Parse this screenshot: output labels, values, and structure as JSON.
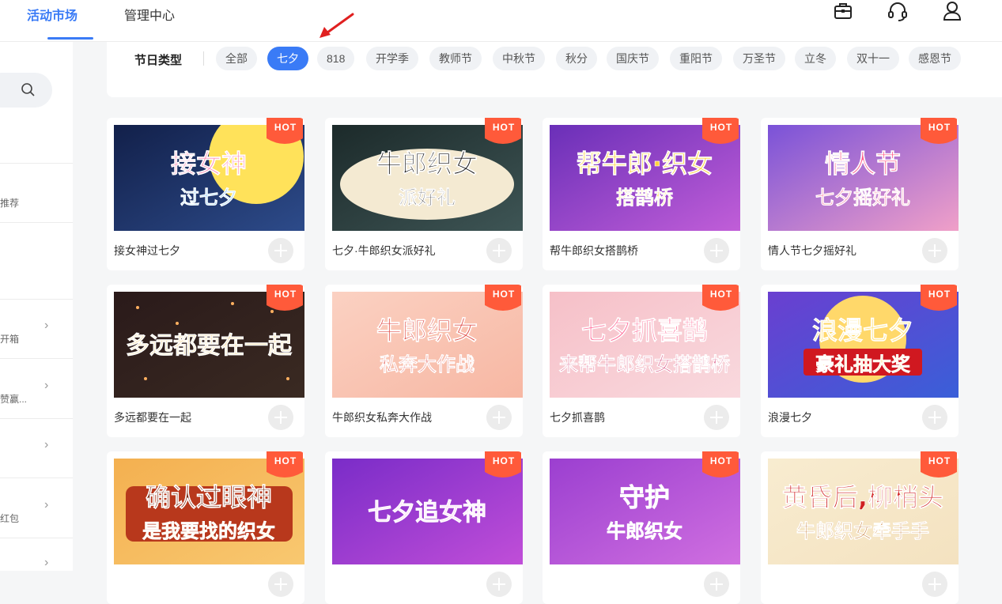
{
  "topnav": {
    "tabs": [
      {
        "label": "活动市场",
        "active": true
      },
      {
        "label": "管理中心",
        "active": false
      }
    ],
    "icons": [
      "briefcase-icon",
      "headset-icon",
      "user-icon"
    ],
    "accent_color": "#3a7bf6"
  },
  "sidebar": {
    "items": [
      {
        "label": "推荐"
      },
      {
        "label": "开箱"
      },
      {
        "label": "赞赢..."
      },
      {
        "label": ""
      },
      {
        "label": "红包"
      },
      {
        "label": ""
      }
    ]
  },
  "filter": {
    "title": "节日类型",
    "chips": [
      "全部",
      "七夕",
      "818",
      "开学季",
      "教师节",
      "中秋节",
      "秋分",
      "国庆节",
      "重阳节",
      "万圣节",
      "立冬",
      "双十一",
      "感恩节"
    ],
    "active": "七夕"
  },
  "hot_label": "HOT",
  "cards": [
    {
      "title": "接女神过七夕",
      "thumb_text": [
        "接女神",
        "过七夕"
      ]
    },
    {
      "title": "七夕·牛郎织女派好礼",
      "thumb_text": [
        "牛郎织女",
        "派好礼"
      ]
    },
    {
      "title": "帮牛郎织女搭鹊桥",
      "thumb_text": [
        "帮牛郎·织女",
        "搭鹊桥"
      ]
    },
    {
      "title": "情人节七夕摇好礼",
      "thumb_text": [
        "情人节",
        "七夕摇好礼"
      ]
    },
    {
      "title": "多远都要在一起",
      "thumb_text": [
        "多远都要在一起"
      ]
    },
    {
      "title": "牛郎织女私奔大作战",
      "thumb_text": [
        "牛郎织女",
        "私奔大作战"
      ]
    },
    {
      "title": "七夕抓喜鹊",
      "thumb_text": [
        "七夕抓喜鹊",
        "来帮牛郎织女搭鹊桥"
      ]
    },
    {
      "title": "浪漫七夕",
      "thumb_text": [
        "浪漫七夕",
        "豪礼抽大奖"
      ]
    },
    {
      "title": "",
      "thumb_text": [
        "确认过眼神",
        "是我要找的织女"
      ]
    },
    {
      "title": "",
      "thumb_text": [
        "七夕追女神"
      ]
    },
    {
      "title": "",
      "thumb_text": [
        "守护",
        "牛郎织女"
      ]
    },
    {
      "title": "",
      "thumb_text": [
        "黄昏后,柳梢头",
        "牛郎织女牵手手"
      ]
    }
  ]
}
